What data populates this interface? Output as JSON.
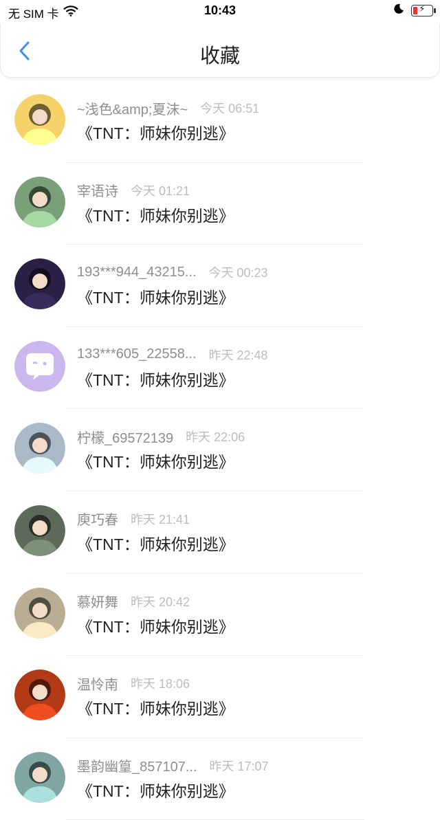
{
  "status_bar": {
    "carrier": "无 SIM 卡",
    "time": "10:43"
  },
  "nav": {
    "title": "收藏"
  },
  "favorites": [
    {
      "name": "~浅色&amp;夏沫~",
      "time": "今天 06:51",
      "work": "《TNT：师妹你别逃》",
      "avatar_icon": "boy-portrait-avatar",
      "avatar_color": "#f6d36a"
    },
    {
      "name": "宰语诗",
      "time": "今天 01:21",
      "work": "《TNT：师妹你别逃》",
      "avatar_icon": "girl-with-flowers-avatar",
      "avatar_color": "#7aa079"
    },
    {
      "name": "193***944_43215...",
      "time": "今天 00:23",
      "work": "《TNT：师妹你别逃》",
      "avatar_icon": "cartoon-character-avatar",
      "avatar_color": "#2a1f44"
    },
    {
      "name": "133***605_22558...",
      "time": "昨天 22:48",
      "work": "《TNT：师妹你别逃》",
      "avatar_icon": "chat-bubble-default-avatar",
      "avatar_color": "#cbb6ee"
    },
    {
      "name": "柠檬_69572139",
      "time": "昨天 22:06",
      "work": "《TNT：师妹你别逃》",
      "avatar_icon": "girl-with-hat-avatar",
      "avatar_color": "#a9b9c8"
    },
    {
      "name": "庾巧春",
      "time": "昨天 21:41",
      "work": "《TNT：师妹你别逃》",
      "avatar_icon": "girl-portrait-avatar",
      "avatar_color": "#5d6a5a"
    },
    {
      "name": "慕妍舞",
      "time": "昨天 20:42",
      "work": "《TNT：师妹你别逃》",
      "avatar_icon": "girl-portrait-avatar",
      "avatar_color": "#b9ad93"
    },
    {
      "name": "温怜南",
      "time": "昨天 18:06",
      "work": "《TNT：师妹你别逃》",
      "avatar_icon": "buddha-statue-avatar",
      "avatar_color": "#b23a16"
    },
    {
      "name": "墨韵幽篁_857107...",
      "time": "昨天 17:07",
      "work": "《TNT：师妹你别逃》",
      "avatar_icon": "anime-girl-avatar",
      "avatar_color": "#7fa6a3"
    }
  ]
}
